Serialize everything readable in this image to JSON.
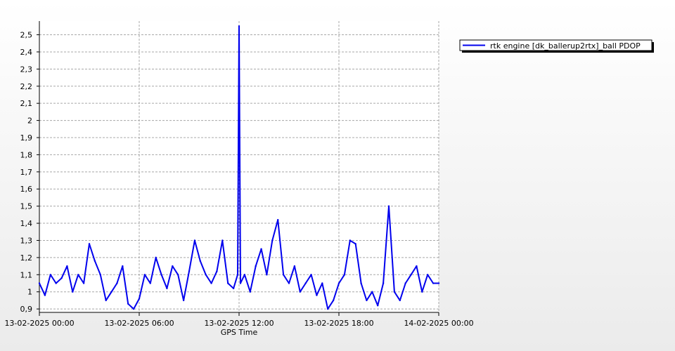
{
  "chart_data": {
    "type": "line",
    "title": "",
    "xlabel": "GPS Time",
    "ylabel": "",
    "ylim": [
      0.88,
      2.58
    ],
    "yticks": [
      "0,9",
      "1",
      "1,1",
      "1,2",
      "1,3",
      "1,4",
      "1,5",
      "1,6",
      "1,7",
      "1,8",
      "1,9",
      "2",
      "2,1",
      "2,2",
      "2,3",
      "2,4",
      "2,5"
    ],
    "ytick_values": [
      0.9,
      1.0,
      1.1,
      1.2,
      1.3,
      1.4,
      1.5,
      1.6,
      1.7,
      1.8,
      1.9,
      2.0,
      2.1,
      2.2,
      2.3,
      2.4,
      2.5
    ],
    "xlim": [
      "13-02-2025 00:00",
      "14-02-2025 00:00"
    ],
    "xticks": [
      "13-02-2025 00:00",
      "13-02-2025 06:00",
      "13-02-2025 12:00",
      "13-02-2025 18:00",
      "14-02-2025 00:00"
    ],
    "grid": true,
    "legend_position": "top-right",
    "series": [
      {
        "name": "rtk engine [dk_ballerup2rtx]_ball PDOP",
        "color": "#0000ee",
        "x": [
          "00:00",
          "00:20",
          "00:40",
          "01:00",
          "01:20",
          "01:40",
          "02:00",
          "02:20",
          "02:40",
          "03:00",
          "03:20",
          "03:40",
          "04:00",
          "04:20",
          "04:40",
          "05:00",
          "05:20",
          "05:40",
          "06:00",
          "06:20",
          "06:40",
          "07:00",
          "07:20",
          "07:40",
          "08:00",
          "08:20",
          "08:40",
          "09:00",
          "09:20",
          "09:40",
          "10:00",
          "10:20",
          "10:40",
          "11:00",
          "11:20",
          "11:40",
          "11:55",
          "12:00",
          "12:05",
          "12:20",
          "12:40",
          "13:00",
          "13:20",
          "13:40",
          "14:00",
          "14:20",
          "14:40",
          "15:00",
          "15:20",
          "15:40",
          "16:00",
          "16:20",
          "16:40",
          "17:00",
          "17:20",
          "17:40",
          "18:00",
          "18:20",
          "18:40",
          "19:00",
          "19:20",
          "19:40",
          "20:00",
          "20:20",
          "20:40",
          "21:00",
          "21:20",
          "21:40",
          "22:00",
          "22:20",
          "22:40",
          "23:00",
          "23:20",
          "23:40",
          "24:00"
        ],
        "y": [
          1.05,
          0.98,
          1.1,
          1.05,
          1.08,
          1.15,
          1.0,
          1.1,
          1.05,
          1.28,
          1.18,
          1.1,
          0.95,
          1.0,
          1.05,
          1.15,
          0.93,
          0.9,
          0.96,
          1.1,
          1.05,
          1.2,
          1.1,
          1.02,
          1.15,
          1.1,
          0.95,
          1.12,
          1.3,
          1.18,
          1.1,
          1.05,
          1.12,
          1.3,
          1.05,
          1.02,
          1.1,
          2.55,
          1.05,
          1.1,
          1.0,
          1.15,
          1.25,
          1.1,
          1.3,
          1.42,
          1.1,
          1.05,
          1.15,
          1.0,
          1.05,
          1.1,
          0.98,
          1.05,
          0.9,
          0.95,
          1.05,
          1.1,
          1.3,
          1.28,
          1.05,
          0.95,
          1.0,
          0.92,
          1.05,
          1.5,
          1.0,
          0.95,
          1.05,
          1.1,
          1.15,
          1.0,
          1.1,
          1.05,
          1.05
        ]
      }
    ]
  }
}
